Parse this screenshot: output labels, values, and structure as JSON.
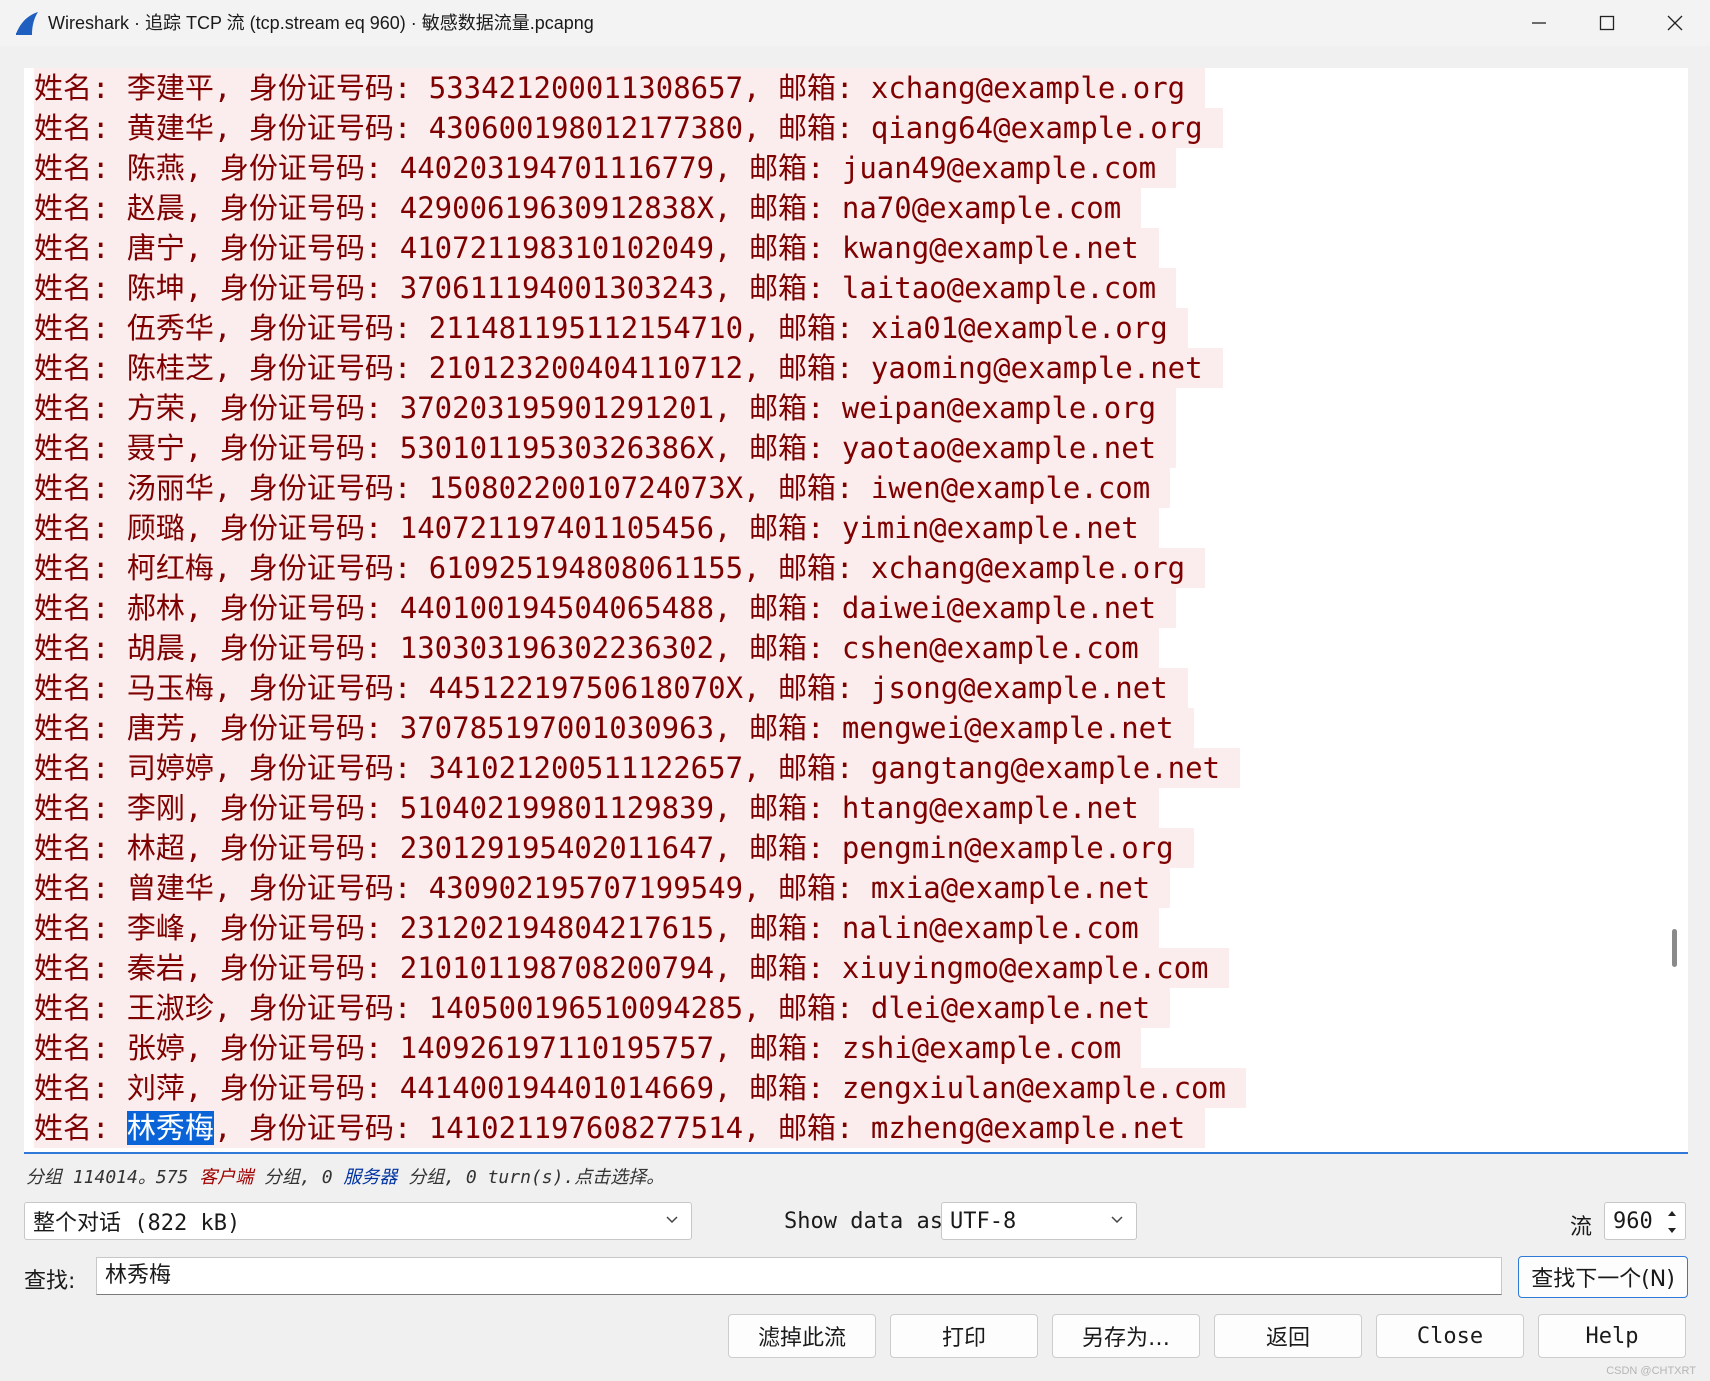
{
  "window": {
    "title": "Wireshark · 追踪 TCP 流 (tcp.stream eq 960) · 敏感数据流量.pcapng"
  },
  "stream": {
    "lines": [
      {
        "before": "姓名: 李建平, 身份证号码: 533421200011308657, 邮箱: xchang@example.org",
        "highlight": "",
        "after": ""
      },
      {
        "before": "姓名: 黄建华, 身份证号码: 430600198012177380, 邮箱: qiang64@example.org",
        "highlight": "",
        "after": ""
      },
      {
        "before": "姓名: 陈燕, 身份证号码: 440203194701116779, 邮箱: juan49@example.com",
        "highlight": "",
        "after": ""
      },
      {
        "before": "姓名: 赵晨, 身份证号码: 42900619630912838X, 邮箱: na70@example.com",
        "highlight": "",
        "after": ""
      },
      {
        "before": "姓名: 唐宁, 身份证号码: 410721198310102049, 邮箱: kwang@example.net",
        "highlight": "",
        "after": ""
      },
      {
        "before": "姓名: 陈坤, 身份证号码: 370611194001303243, 邮箱: laitao@example.com",
        "highlight": "",
        "after": ""
      },
      {
        "before": "姓名: 伍秀华, 身份证号码: 211481195112154710, 邮箱: xia01@example.org",
        "highlight": "",
        "after": ""
      },
      {
        "before": "姓名: 陈桂芝, 身份证号码: 210123200404110712, 邮箱: yaoming@example.net",
        "highlight": "",
        "after": ""
      },
      {
        "before": "姓名: 方荣, 身份证号码: 370203195901291201, 邮箱: weipan@example.org",
        "highlight": "",
        "after": ""
      },
      {
        "before": "姓名: 聂宁, 身份证号码: 53010119530326386X, 邮箱: yaotao@example.net",
        "highlight": "",
        "after": ""
      },
      {
        "before": "姓名: 汤丽华, 身份证号码: 15080220010724073X, 邮箱: iwen@example.com",
        "highlight": "",
        "after": ""
      },
      {
        "before": "姓名: 顾璐, 身份证号码: 140721197401105456, 邮箱: yimin@example.net",
        "highlight": "",
        "after": ""
      },
      {
        "before": "姓名: 柯红梅, 身份证号码: 610925194808061155, 邮箱: xchang@example.org",
        "highlight": "",
        "after": ""
      },
      {
        "before": "姓名: 郝林, 身份证号码: 440100194504065488, 邮箱: daiwei@example.net",
        "highlight": "",
        "after": ""
      },
      {
        "before": "姓名: 胡晨, 身份证号码: 130303196302236302, 邮箱: cshen@example.com",
        "highlight": "",
        "after": ""
      },
      {
        "before": "姓名: 马玉梅, 身份证号码: 44512219750618070X, 邮箱: jsong@example.net",
        "highlight": "",
        "after": ""
      },
      {
        "before": "姓名: 唐芳, 身份证号码: 370785197001030963, 邮箱: mengwei@example.net",
        "highlight": "",
        "after": ""
      },
      {
        "before": "姓名: 司婷婷, 身份证号码: 341021200511122657, 邮箱: gangtang@example.net",
        "highlight": "",
        "after": ""
      },
      {
        "before": "姓名: 李刚, 身份证号码: 510402199801129839, 邮箱: htang@example.net",
        "highlight": "",
        "after": ""
      },
      {
        "before": "姓名: 林超, 身份证号码: 230129195402011647, 邮箱: pengmin@example.org",
        "highlight": "",
        "after": ""
      },
      {
        "before": "姓名: 曾建华, 身份证号码: 430902195707199549, 邮箱: mxia@example.net",
        "highlight": "",
        "after": ""
      },
      {
        "before": "姓名: 李峰, 身份证号码: 231202194804217615, 邮箱: nalin@example.com",
        "highlight": "",
        "after": ""
      },
      {
        "before": "姓名: 秦岩, 身份证号码: 210101198708200794, 邮箱: xiuyingmo@example.com",
        "highlight": "",
        "after": ""
      },
      {
        "before": "姓名: 王淑珍, 身份证号码: 140500196510094285, 邮箱: dlei@example.net",
        "highlight": "",
        "after": ""
      },
      {
        "before": "姓名: 张婷, 身份证号码: 140926197110195757, 邮箱: zshi@example.com",
        "highlight": "",
        "after": ""
      },
      {
        "before": "姓名: 刘萍, 身份证号码: 441400194401014669, 邮箱: zengxiulan@example.com",
        "highlight": "",
        "after": ""
      },
      {
        "before": "姓名: ",
        "highlight": "林秀梅",
        "after": ", 身份证号码: 141021197608277514, 邮箱: mzheng@example.net"
      }
    ]
  },
  "status": {
    "prefix": "分组 114014。575 ",
    "client": "客户端",
    "middle": " 分组, 0 ",
    "server": "服务器",
    "suffix": " 分组, 0 turn(s).点击选择。"
  },
  "controls": {
    "conversation_select": "整个对话 (822 kB)",
    "show_data_label": "Show data as",
    "encoding_select": "UTF-8",
    "stream_label": "流",
    "stream_value": "960"
  },
  "find": {
    "label": "查找:",
    "value": "林秀梅",
    "find_next_label": "查找下一个(N)"
  },
  "buttons": {
    "filter_out": "滤掉此流",
    "print": "打印",
    "save_as": "另存为…",
    "back": "返回",
    "close": "Close",
    "help": "Help"
  },
  "watermark": "CSDN @CHTXRT",
  "colors": {
    "client_text": "#7f0000",
    "client_bg": "#fbeded",
    "selection": "#0a64d8",
    "server_text": "#0033a0",
    "accent": "#2f7ad8"
  }
}
